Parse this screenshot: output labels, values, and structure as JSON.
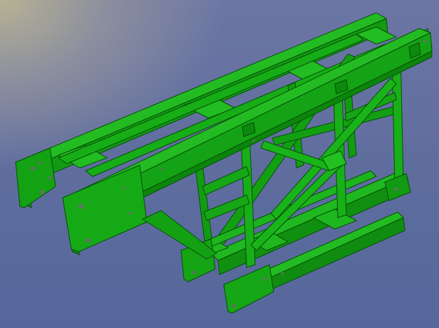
{
  "scene": {
    "background_top": "#6c76a4",
    "background_bottom": "#56679c",
    "highlight": "#b7b294",
    "model_color": "#14a614",
    "model_dark": "#0b7a0b",
    "model_light": "#27c427",
    "model_edge": "#064f06",
    "hole_color": "#6d7f6d"
  }
}
